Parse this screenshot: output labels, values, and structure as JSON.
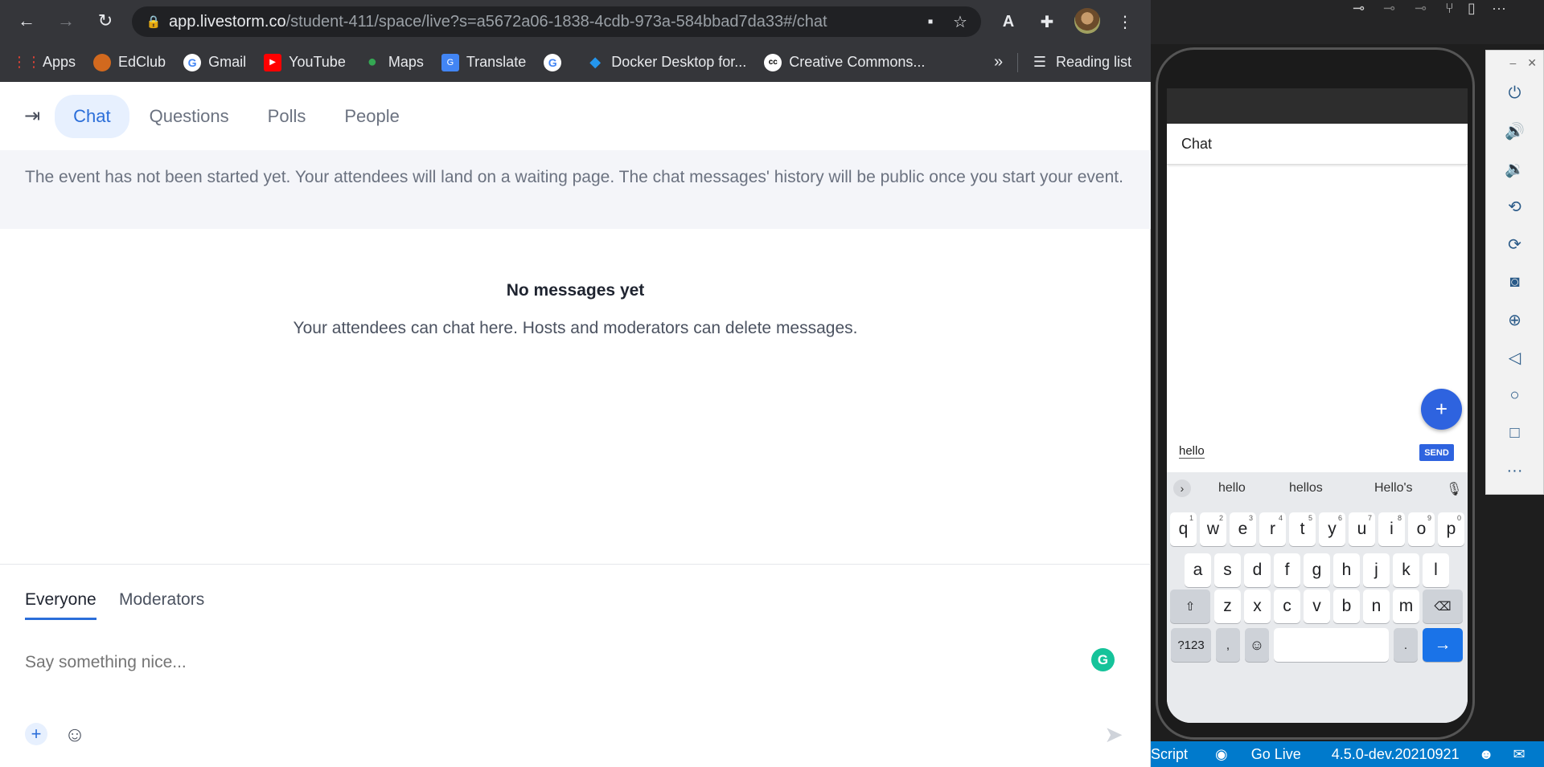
{
  "browser": {
    "url_host": "app.livestorm.co",
    "url_path": "/student-411/space/live?s=a5672a06-1838-4cdb-973a-584bbad7da33#/chat",
    "bookmarks": [
      "Apps",
      "EdClub",
      "Gmail",
      "YouTube",
      "Maps",
      "Translate",
      "Docker Desktop for...",
      "Creative Commons..."
    ],
    "more_label": "»",
    "reading_list": "Reading list"
  },
  "app": {
    "tabs": [
      "Chat",
      "Questions",
      "Polls",
      "People"
    ],
    "banner": "The event has not been started yet. Your attendees will land on a waiting page. The chat messages' history will be public once you start your event.",
    "empty_title": "No messages yet",
    "empty_sub": "Your attendees can chat here. Hosts and moderators can delete messages.",
    "composer_tabs": [
      "Everyone",
      "Moderators"
    ],
    "input_placeholder": "Say something nice...",
    "grammarly_letter": "G"
  },
  "phone": {
    "app_title": "Chat",
    "input_value": "hello",
    "send_label": "SEND",
    "suggestions": [
      "hello",
      "hellos",
      "Hello's"
    ],
    "row1": [
      "q",
      "w",
      "e",
      "r",
      "t",
      "y",
      "u",
      "i",
      "o",
      "p"
    ],
    "row1_nums": [
      "1",
      "2",
      "3",
      "4",
      "5",
      "6",
      "7",
      "8",
      "9",
      "0"
    ],
    "row2": [
      "a",
      "s",
      "d",
      "f",
      "g",
      "h",
      "j",
      "k",
      "l"
    ],
    "row3": [
      "z",
      "x",
      "c",
      "v",
      "b",
      "n",
      "m"
    ],
    "sym_key": "?123",
    "comma_key": ",",
    "period_key": "."
  },
  "vscode": {
    "status_items": [
      "Script",
      "Go Live",
      "4.5.0-dev.20210921"
    ]
  }
}
